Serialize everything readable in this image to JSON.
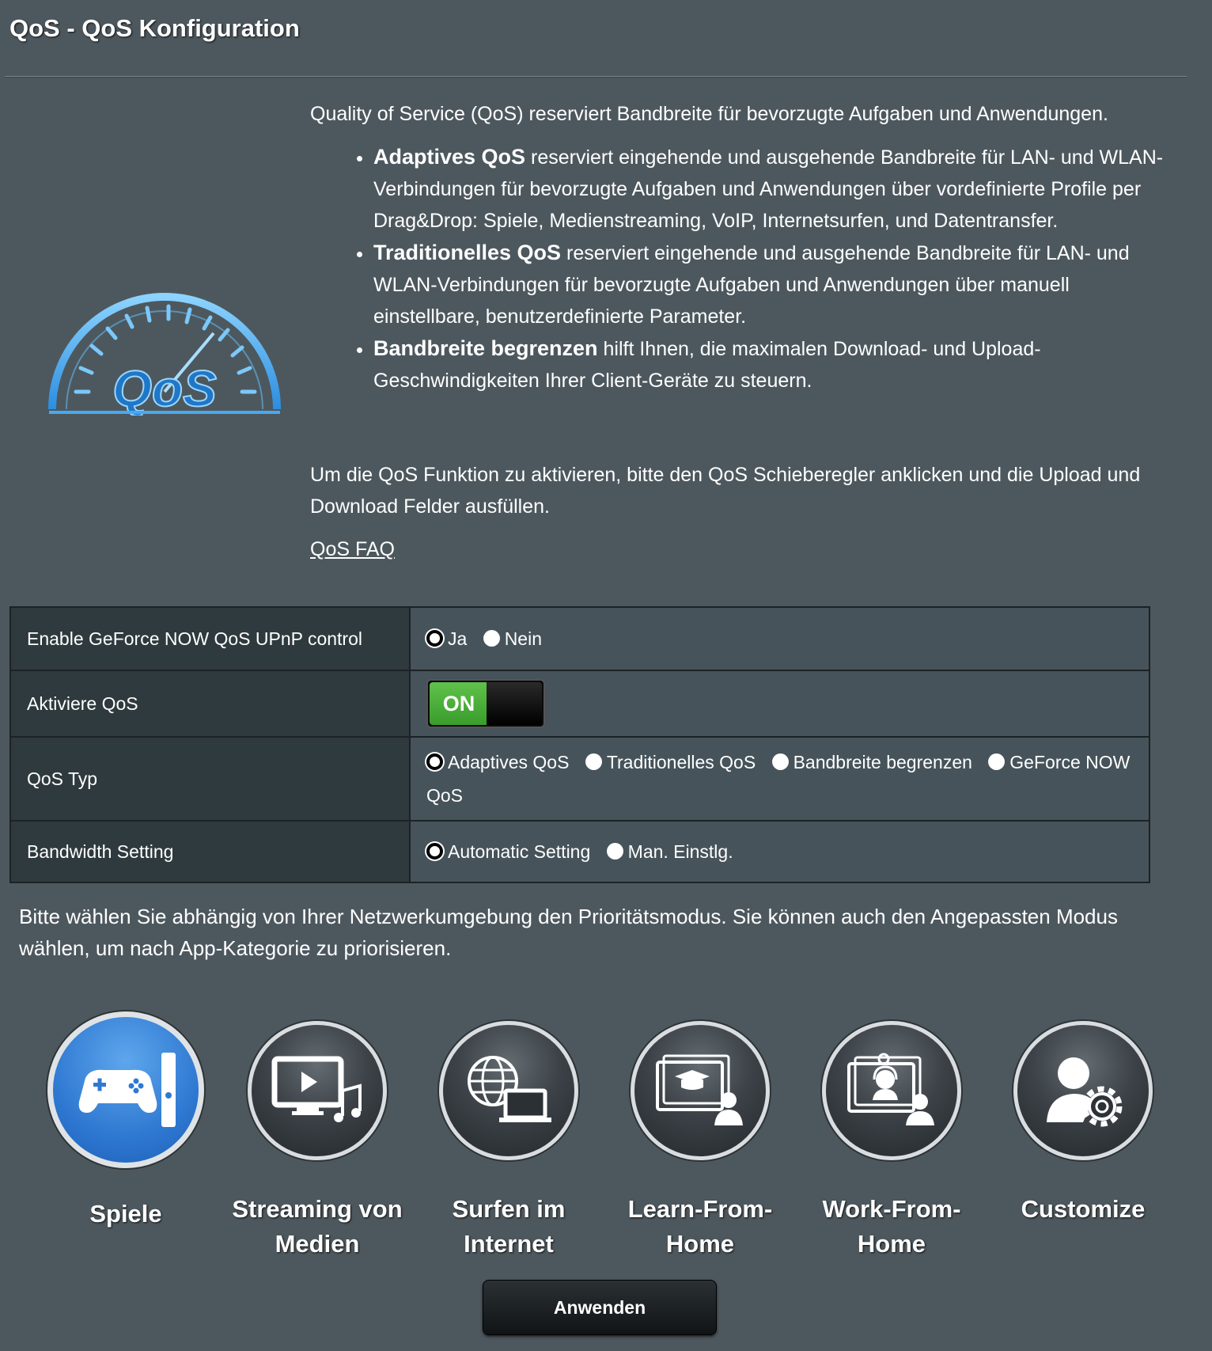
{
  "header": {
    "title": "QoS - QoS Konfiguration"
  },
  "logo": {
    "text": "QoS"
  },
  "intro": {
    "lead": "Quality of Service (QoS) reserviert Bandbreite für bevorzugte Aufgaben und Anwendungen.",
    "bullets": [
      {
        "term": "Adaptives QoS",
        "text": " reserviert eingehende und ausgehende Bandbreite für LAN- und WLAN-Verbindungen für bevorzugte Aufgaben und Anwendungen über vordefinierte Profile per Drag&Drop: Spiele, Medienstreaming, VoIP, Internetsurfen, und Datentransfer."
      },
      {
        "term": "Traditionelles QoS",
        "text": " reserviert eingehende und ausgehende Bandbreite für LAN- und WLAN-Verbindungen für bevorzugte Aufgaben und Anwendungen über manuell einstellbare, benutzerdefinierte Parameter."
      },
      {
        "term": "Bandbreite begrenzen",
        "text": " hilft Ihnen, die maximalen Download- und Upload-Geschwindigkeiten Ihrer Client-Geräte zu steuern."
      }
    ],
    "note": "Um die QoS Funktion zu aktivieren, bitte den QoS Schieberegler anklicken und die Upload und Download Felder ausfüllen.",
    "faq_link": "QoS FAQ"
  },
  "settings": {
    "geforce": {
      "label": "Enable GeForce NOW QoS UPnP control",
      "options": [
        "Ja",
        "Nein"
      ],
      "selected": "Ja"
    },
    "enable_qos": {
      "label": "Aktiviere QoS",
      "toggle_text": "ON",
      "value": true
    },
    "qos_type": {
      "label": "QoS Typ",
      "options": [
        "Adaptives QoS",
        "Traditionelles QoS",
        "Bandbreite begrenzen",
        "GeForce NOW QoS"
      ],
      "selected": "Adaptives QoS"
    },
    "bandwidth": {
      "label": "Bandwidth Setting",
      "options": [
        "Automatic Setting",
        "Man. Einstlg."
      ],
      "selected": "Automatic Setting"
    }
  },
  "priority": {
    "text": "Bitte wählen Sie abhängig von Ihrer Netzwerkumgebung den Prioritätsmodus. Sie können auch den Angepassten Modus wählen, um nach App-Kategorie zu priorisieren.",
    "modes": [
      {
        "line1": "Spiele",
        "line2": "",
        "icon": "gamepad-icon",
        "active": true
      },
      {
        "line1": "Streaming von",
        "line2": "Medien",
        "icon": "media-streaming-icon",
        "active": false
      },
      {
        "line1": "Surfen im",
        "line2": "Internet",
        "icon": "web-surfing-icon",
        "active": false
      },
      {
        "line1": "Learn-From-",
        "line2": "Home",
        "icon": "learn-from-home-icon",
        "active": false
      },
      {
        "line1": "Work-From-",
        "line2": "Home",
        "icon": "work-from-home-icon",
        "active": false
      },
      {
        "line1": "Customize",
        "line2": "",
        "icon": "customize-icon",
        "active": false
      }
    ]
  },
  "apply_button": "Anwenden",
  "colors": {
    "background": "#4d585e",
    "accent_blue": "#2f79d2",
    "toggle_green": "#4bb33a"
  }
}
